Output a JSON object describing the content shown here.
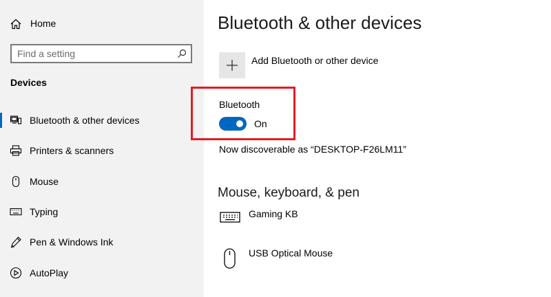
{
  "sidebar": {
    "home": {
      "label": "Home",
      "icon": "home-icon"
    },
    "search": {
      "placeholder": "Find a setting",
      "value": "",
      "icon": "search-icon"
    },
    "section_heading": "Devices",
    "items": [
      {
        "label": "Bluetooth & other devices",
        "icon": "bluetooth-devices-icon",
        "active": true
      },
      {
        "label": "Printers & scanners",
        "icon": "printer-icon",
        "active": false
      },
      {
        "label": "Mouse",
        "icon": "mouse-icon",
        "active": false
      },
      {
        "label": "Typing",
        "icon": "keyboard-icon",
        "active": false
      },
      {
        "label": "Pen & Windows Ink",
        "icon": "pen-icon",
        "active": false
      },
      {
        "label": "AutoPlay",
        "icon": "autoplay-icon",
        "active": false
      }
    ]
  },
  "main": {
    "title": "Bluetooth & other devices",
    "add_device_label": "Add Bluetooth or other device",
    "bluetooth": {
      "label": "Bluetooth",
      "state_label": "On",
      "enabled": true
    },
    "discoverable_text": "Now discoverable as “DESKTOP-F26LM11”",
    "mouse_section": {
      "heading": "Mouse, keyboard, & pen",
      "devices": [
        {
          "label": "Gaming KB",
          "icon": "keyboard-icon"
        },
        {
          "label": "USB Optical Mouse",
          "icon": "mouse-icon"
        }
      ]
    }
  },
  "colors": {
    "accent": "#0067c0",
    "sidebar_bg": "#f2f2f2",
    "highlight_border": "#e21b22"
  }
}
